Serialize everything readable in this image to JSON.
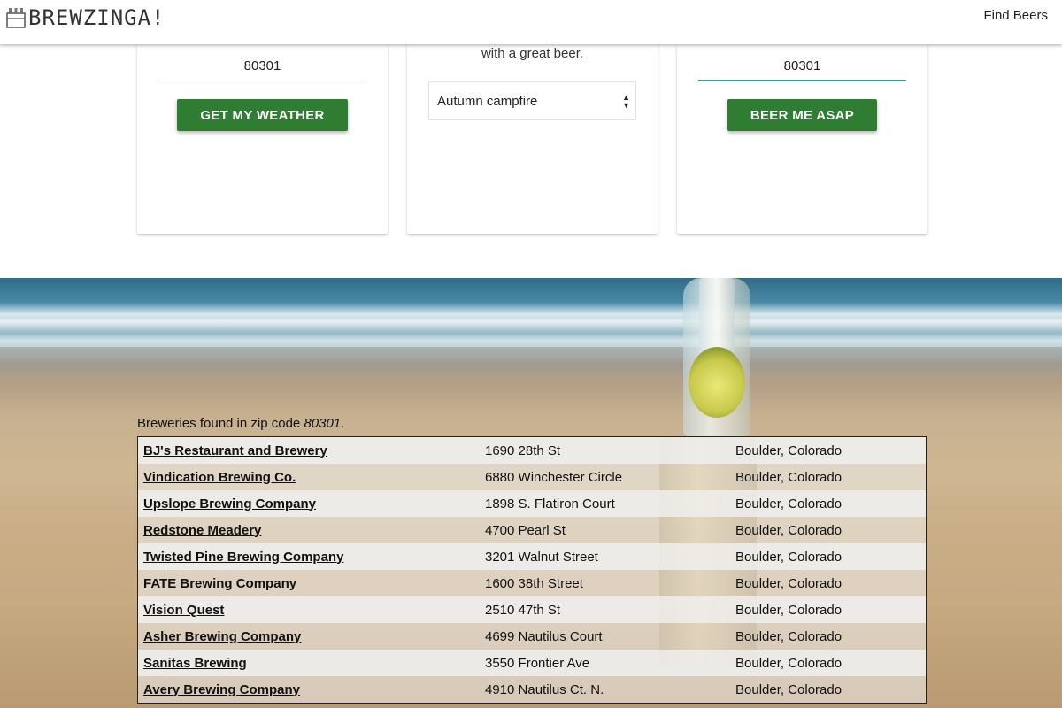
{
  "navbar": {
    "brand": "BREWZINGA!",
    "link": "Find Beers"
  },
  "cards": {
    "weather": {
      "zip_value": "80301",
      "button": "GET MY WEATHER"
    },
    "mood": {
      "text": "with a great beer.",
      "select_value": "Autumn campfire"
    },
    "asap": {
      "zip_value": "80301",
      "button": "BEER ME ASAP"
    }
  },
  "results": {
    "caption_prefix": "Breweries found in zip code ",
    "zip": "80301",
    "caption_suffix": ".",
    "rows": [
      {
        "name": "BJ's Restaurant and Brewery",
        "address": "1690 28th St",
        "city": "Boulder, Colorado"
      },
      {
        "name": "Vindication Brewing Co.",
        "address": "6880 Winchester Circle",
        "city": "Boulder, Colorado"
      },
      {
        "name": "Upslope Brewing Company",
        "address": "1898 S. Flatiron Court",
        "city": "Boulder, Colorado"
      },
      {
        "name": "Redstone Meadery",
        "address": "4700 Pearl St",
        "city": "Boulder, Colorado"
      },
      {
        "name": "Twisted Pine Brewing Company",
        "address": "3201 Walnut Street",
        "city": "Boulder, Colorado"
      },
      {
        "name": "FATE Brewing Company",
        "address": "1600 38th Street",
        "city": "Boulder, Colorado"
      },
      {
        "name": "Vision Quest",
        "address": "2510 47th St",
        "city": "Boulder, Colorado"
      },
      {
        "name": "Asher Brewing Company",
        "address": "4699 Nautilus Court",
        "city": "Boulder, Colorado"
      },
      {
        "name": "Sanitas Brewing",
        "address": "3550 Frontier Ave",
        "city": "Boulder, Colorado"
      },
      {
        "name": "Avery Brewing Company",
        "address": "4910 Nautilus Ct. N.",
        "city": "Boulder, Colorado"
      }
    ]
  },
  "colors": {
    "button_green": "#2e7d32",
    "focus_teal": "#26a69a"
  }
}
